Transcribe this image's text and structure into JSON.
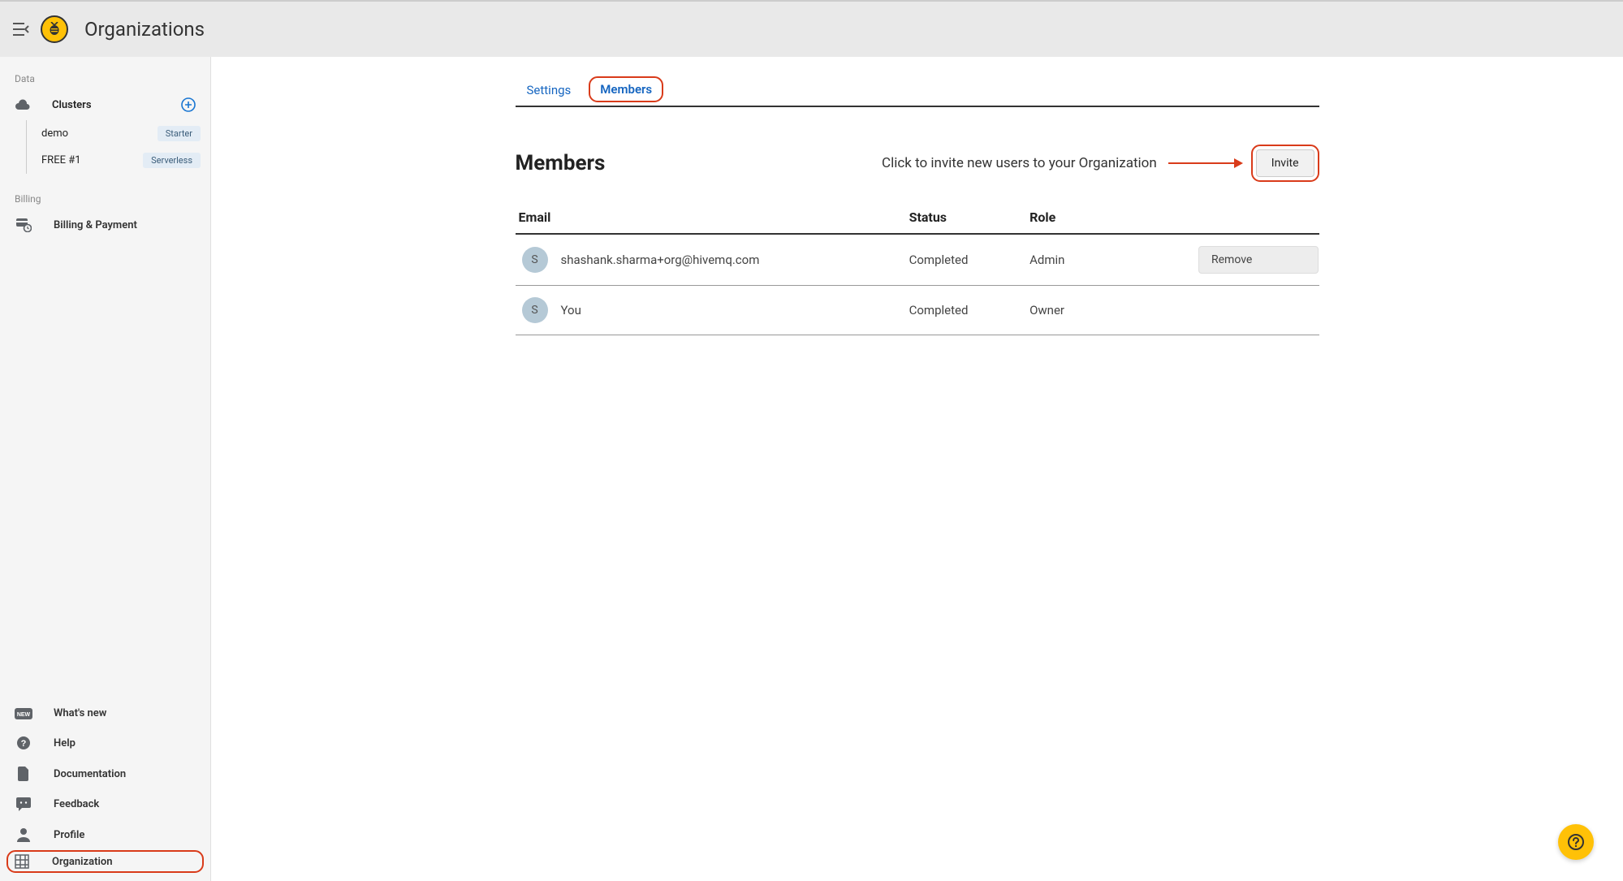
{
  "header": {
    "title": "Organizations"
  },
  "sidebar": {
    "section_data_label": "Data",
    "clusters_label": "Clusters",
    "clusters": [
      {
        "name": "demo",
        "badge": "Starter"
      },
      {
        "name": "FREE #1",
        "badge": "Serverless"
      }
    ],
    "section_billing_label": "Billing",
    "billing_label": "Billing & Payment",
    "footer": {
      "whats_new": "What's new",
      "help": "Help",
      "documentation": "Documentation",
      "feedback": "Feedback",
      "profile": "Profile",
      "organization": "Organization"
    }
  },
  "main": {
    "tabs": {
      "settings": "Settings",
      "members": "Members"
    },
    "section_title": "Members",
    "annotation": "Click to invite new users to your Organization",
    "invite_label": "Invite",
    "table": {
      "headers": {
        "email": "Email",
        "status": "Status",
        "role": "Role"
      },
      "rows": [
        {
          "avatar": "S",
          "email": "shashank.sharma+org@hivemq.com",
          "status": "Completed",
          "role": "Admin",
          "action": "Remove"
        },
        {
          "avatar": "S",
          "email": "You",
          "status": "Completed",
          "role": "Owner",
          "action": ""
        }
      ]
    }
  }
}
